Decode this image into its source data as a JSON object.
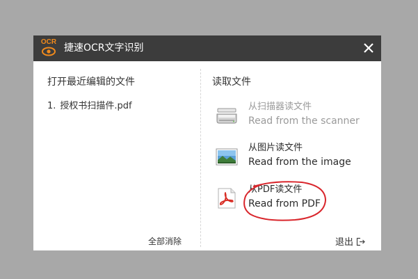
{
  "window": {
    "title": "捷速OCR文字识别",
    "logo_text": "OCR"
  },
  "colors": {
    "titlebar": "#3c3c3c",
    "logo_accent": "#f08a1c",
    "highlight_circle": "#d9262c",
    "disabled_text": "#9a9a9a",
    "pdf_red": "#d82c24"
  },
  "recent": {
    "title": "打开最近编辑的文件",
    "items": [
      {
        "number": "1.",
        "name": "授权书扫描件.pdf"
      }
    ],
    "clear_label": "全部消除"
  },
  "read": {
    "title": "读取文件",
    "options": [
      {
        "icon": "scanner-icon",
        "cn": "从扫描器读文件",
        "en": "Read from the scanner",
        "enabled": false
      },
      {
        "icon": "image-icon",
        "cn": "从图片读文件",
        "en": "Read from the image",
        "enabled": true
      },
      {
        "icon": "pdf-icon",
        "cn": "从PDF读文件",
        "en": "Read from PDF",
        "enabled": true,
        "highlighted": true
      }
    ]
  },
  "footer": {
    "exit_label": "退出"
  }
}
